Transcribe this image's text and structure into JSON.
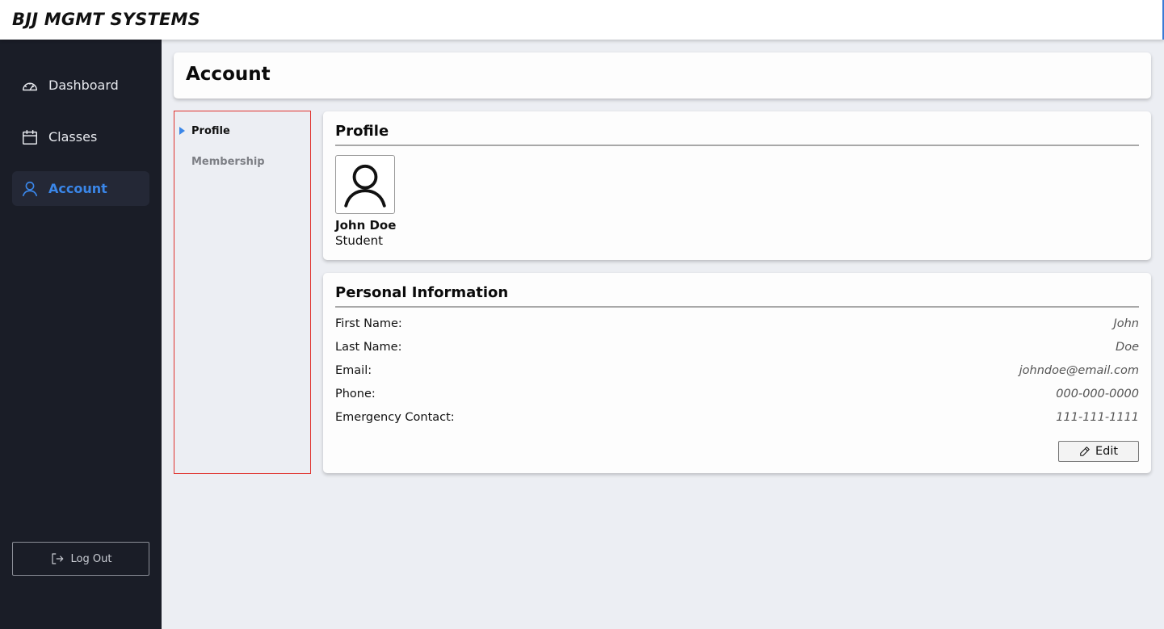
{
  "app": {
    "brand": "BJJ MGMT SYSTEMS"
  },
  "sidebar": {
    "items": [
      {
        "label": "Dashboard",
        "icon": "gauge-icon",
        "active": false
      },
      {
        "label": "Classes",
        "icon": "calendar-icon",
        "active": false
      },
      {
        "label": "Account",
        "icon": "user-icon",
        "active": true
      }
    ],
    "logout_label": "Log Out",
    "logout_icon": "sign-out-icon"
  },
  "page": {
    "title": "Account"
  },
  "subnav": {
    "items": [
      {
        "label": "Profile",
        "active": true
      },
      {
        "label": "Membership",
        "active": false
      }
    ]
  },
  "profile": {
    "title": "Profile",
    "name": "John Doe",
    "role": "Student",
    "avatar_icon": "user-avatar-icon"
  },
  "personal": {
    "title": "Personal Information",
    "rows": [
      {
        "label": "First Name:",
        "value": "John"
      },
      {
        "label": "Last Name:",
        "value": "Doe"
      },
      {
        "label": "Email:",
        "value": "johndoe@email.com"
      },
      {
        "label": "Phone:",
        "value": "000-000-0000"
      },
      {
        "label": "Emergency Contact:",
        "value": "111-111-1111"
      }
    ],
    "edit_label": "Edit",
    "edit_icon": "pencil-icon"
  },
  "colors": {
    "sidebar_bg": "#1a1d27",
    "accent": "#3a86e8",
    "page_bg": "#eceef3",
    "subnav_border": "#e0322e"
  }
}
